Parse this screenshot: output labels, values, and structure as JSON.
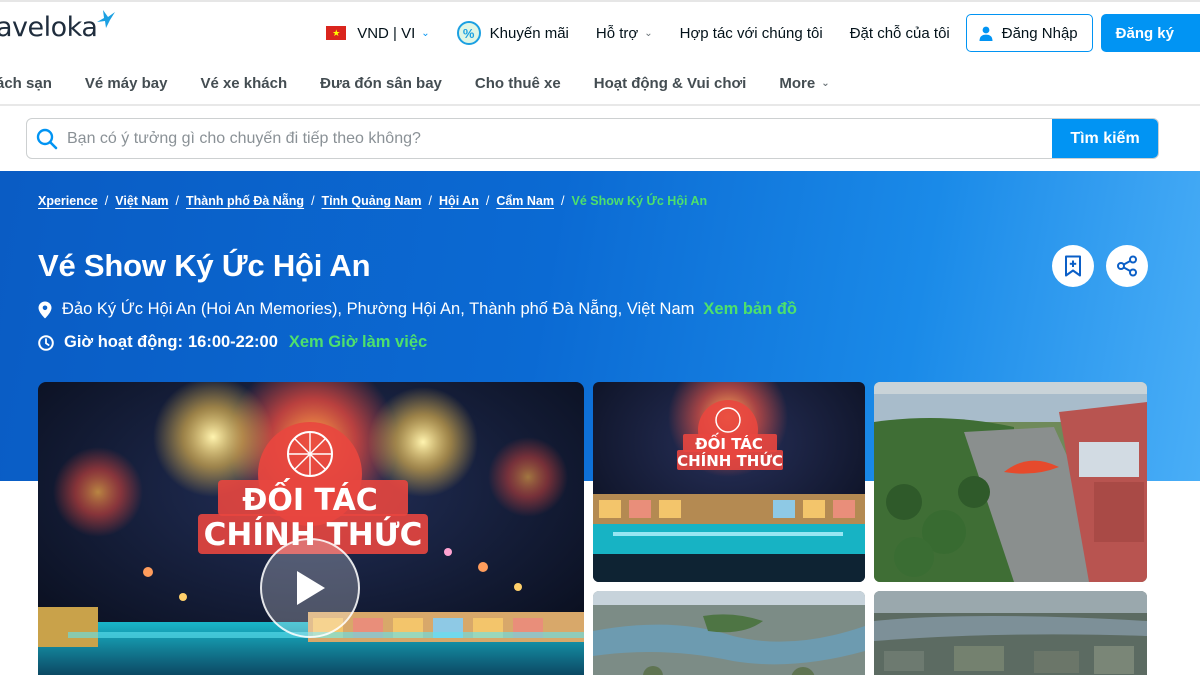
{
  "brand": {
    "logo_text": "aveloka"
  },
  "header": {
    "currency_lang": "VND | VI",
    "promo": "Khuyến mãi",
    "support": "Hỗ trợ",
    "partner": "Hợp tác với chúng tôi",
    "bookings": "Đặt chỗ của tôi",
    "login": "Đăng Nhập",
    "signup": "Đăng ký"
  },
  "categories": [
    "ách sạn",
    "Vé máy bay",
    "Vé xe khách",
    "Đưa đón sân bay",
    "Cho thuê xe",
    "Hoạt động & Vui chơi",
    "More"
  ],
  "search": {
    "placeholder": "Bạn có ý tưởng gì cho chuyến đi tiếp theo không?",
    "button": "Tìm kiếm"
  },
  "breadcrumb": {
    "items": [
      "Xperience",
      "Việt Nam",
      "Thành phố Đà Nẵng",
      "Tỉnh Quảng Nam",
      "Hội An",
      "Cẩm Nam"
    ],
    "current": "Vé Show Ký Ức Hội An",
    "separator": "/"
  },
  "product": {
    "title": "Vé Show Ký Ức Hội An",
    "address": "Đảo Ký Ức Hội An (Hoi An Memories), Phường Hội An, Thành phố Đà Nẵng, Việt Nam",
    "map_link": "Xem bản đồ",
    "hours_label": "Giờ hoạt động:",
    "hours_value": "16:00-22:00",
    "hours_link": "Xem Giờ làm việc"
  },
  "gallery": {
    "main_banner_line1": "ĐỐI TÁC",
    "main_banner_line2": "CHÍNH THỨC",
    "tile1_line1": "ĐỐI TÁC",
    "tile1_line2": "CHÍNH THỨC"
  },
  "colors": {
    "accent": "#0194f3",
    "green_link": "#4ee06c",
    "hero_start": "#0a5cc4",
    "hero_end": "#49aef7"
  }
}
